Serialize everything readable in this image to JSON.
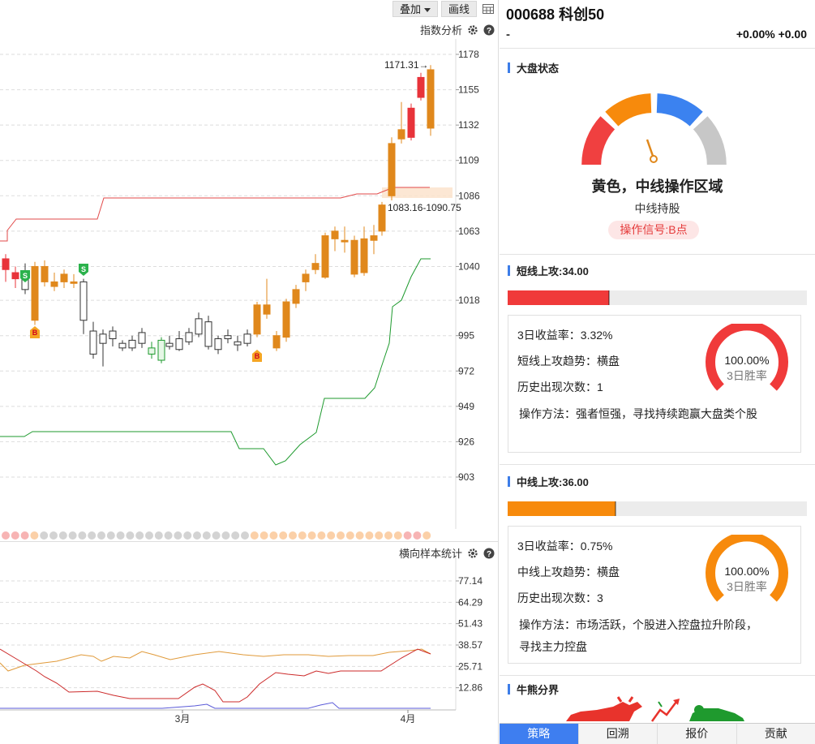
{
  "toolbar": {
    "overlay_label": "叠加",
    "draw_label": "画线"
  },
  "main_panel": {
    "title": "指数分析",
    "price_axis": [
      "1178",
      "1155",
      "1132",
      "1109",
      "1086",
      "1063",
      "1040",
      "1018",
      "995",
      "972",
      "949",
      "926",
      "903"
    ],
    "high_label": "1171.31→",
    "band_label": "1083.16-1090.75",
    "signals": {
      "sell": "S",
      "buy": "B"
    }
  },
  "sub_panel": {
    "title": "横向样本统计",
    "value_axis": [
      "77.14",
      "64.29",
      "51.43",
      "38.57",
      "25.71",
      "12.86"
    ],
    "x_labels": [
      "3月",
      "4月"
    ]
  },
  "stock": {
    "code_name": "000688 科创50",
    "price": "-",
    "change": "+0.00% +0.00"
  },
  "market": {
    "title": "大盘状态",
    "status": "黄色，中线操作区域",
    "advice": "中线持股",
    "signal": "操作信号:B点",
    "colors": {
      "red": "#f04040",
      "orange": "#f78a0c",
      "blue": "#3b82f0",
      "gray": "#c7c7c7"
    }
  },
  "short_attack": {
    "title": "短线上攻:34.00",
    "level_percent": 34,
    "color": "#f03a3a",
    "lines": [
      "3日收益率：3.32%",
      "短线上攻趋势：横盘",
      "历史出现次数：1",
      "操作方法：强者恒强，寻找持续跑赢大盘类个股"
    ],
    "win_rate": "100.00%",
    "win_label": "3日胜率"
  },
  "mid_attack": {
    "title": "中线上攻:36.00",
    "level_percent": 36,
    "color": "#f78a0c",
    "lines": [
      "3日收益率：0.75%",
      "中线上攻趋势：横盘",
      "历史出现次数：3",
      "操作方法：市场活跃，个股进入控盘拉升阶段，",
      "寻找主力控盘"
    ],
    "win_rate": "100.00%",
    "win_label": "3日胜率"
  },
  "bull_bear": {
    "title": "牛熊分界"
  },
  "tabs": [
    "策略",
    "回溯",
    "报价",
    "贡献"
  ]
}
